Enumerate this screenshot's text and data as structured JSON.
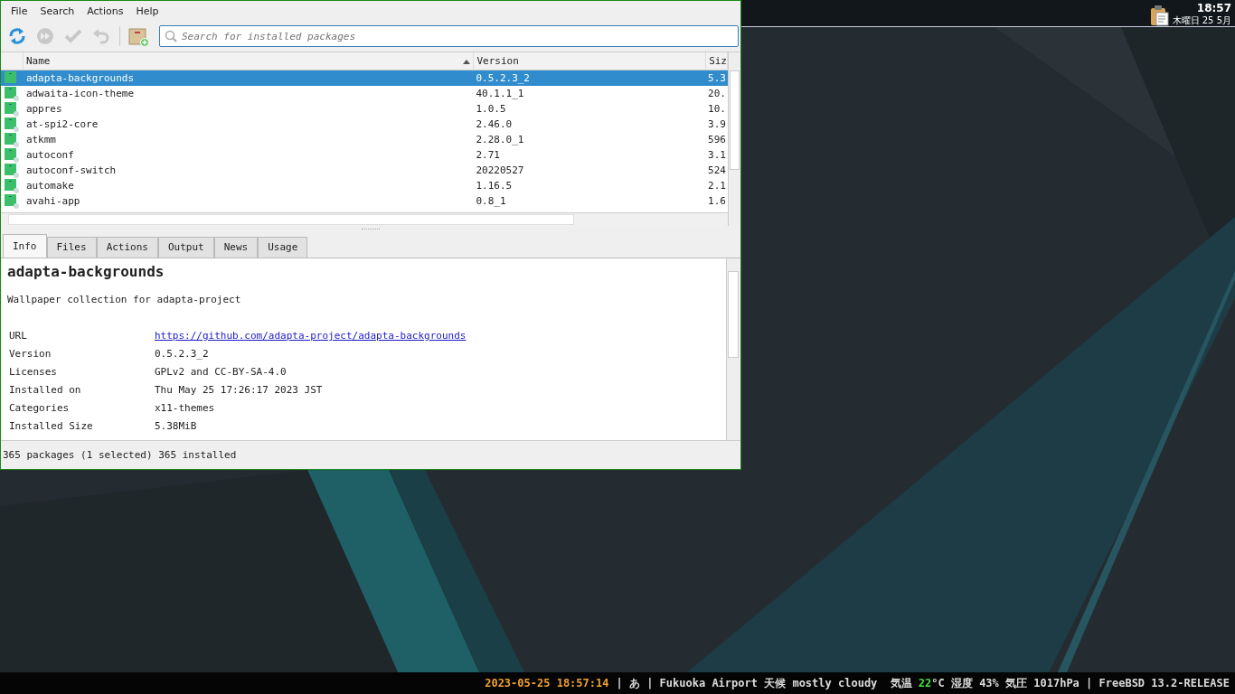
{
  "desktop": {
    "top_panel": {
      "time": "18:57",
      "date": "木曜日 25 5月"
    },
    "status_bar": [
      {
        "text": "2023-05-25 18:57:14",
        "color": "#f0a030"
      },
      {
        "text": "| あ | Fukuoka Airport 天候 mostly cloudy  気温",
        "color": "#dcdcdc"
      },
      {
        "text": "22",
        "color": "#40e040"
      },
      {
        "text": "°C 湿度 43% 気圧 1017hPa | FreeBSD 13.2-RELEASE",
        "color": "#dcdcdc"
      }
    ]
  },
  "window": {
    "menu": [
      "File",
      "Search",
      "Actions",
      "Help"
    ],
    "toolbar": [
      {
        "kind": "refresh",
        "disabled": false
      },
      {
        "kind": "run",
        "disabled": true
      },
      {
        "kind": "apply",
        "disabled": true
      },
      {
        "kind": "undo",
        "disabled": true
      },
      {
        "kind": "install",
        "disabled": false
      }
    ],
    "search": {
      "placeholder": "Search for installed packages"
    },
    "table": {
      "columns": [
        "Name",
        "Version",
        "Siz"
      ],
      "rows": [
        {
          "name": "adapta-backgrounds",
          "version": "0.5.2.3_2",
          "size": "5.3",
          "selected": true
        },
        {
          "name": "adwaita-icon-theme",
          "version": "40.1.1_1",
          "size": "20.",
          "selected": false
        },
        {
          "name": "appres",
          "version": "1.0.5",
          "size": "10.",
          "selected": false
        },
        {
          "name": "at-spi2-core",
          "version": "2.46.0",
          "size": "3.9",
          "selected": false
        },
        {
          "name": "atkmm",
          "version": "2.28.0_1",
          "size": "596",
          "selected": false
        },
        {
          "name": "autoconf",
          "version": "2.71",
          "size": "3.1",
          "selected": false
        },
        {
          "name": "autoconf-switch",
          "version": "20220527",
          "size": "524",
          "selected": false
        },
        {
          "name": "automake",
          "version": "1.16.5",
          "size": "2.1",
          "selected": false
        },
        {
          "name": "avahi-app",
          "version": "0.8_1",
          "size": "1.6",
          "selected": false
        }
      ]
    },
    "tabs": [
      {
        "label": "Info",
        "selected": true
      },
      {
        "label": "Files",
        "selected": false
      },
      {
        "label": "Actions",
        "selected": false
      },
      {
        "label": "Output",
        "selected": false
      },
      {
        "label": "News",
        "selected": false
      },
      {
        "label": "Usage",
        "selected": false
      }
    ],
    "info": {
      "title": "adapta-backgrounds",
      "description": "Wallpaper collection for adapta-project",
      "fields": [
        {
          "label": "URL",
          "value": "https://github.com/adapta-project/adapta-backgrounds",
          "kind": "link"
        },
        {
          "label": "Version",
          "value": "0.5.2.3_2",
          "kind": "text"
        },
        {
          "label": "Licenses",
          "value": "GPLv2 and CC-BY-SA-4.0",
          "kind": "text"
        },
        {
          "label": "Installed on",
          "value": "Thu May 25 17:26:17 2023 JST",
          "kind": "text"
        },
        {
          "label": "Categories",
          "value": "x11-themes",
          "kind": "text"
        },
        {
          "label": "Installed Size",
          "value": "5.38MiB",
          "kind": "text"
        }
      ]
    },
    "status": "365 packages (1 selected)  365 installed"
  }
}
